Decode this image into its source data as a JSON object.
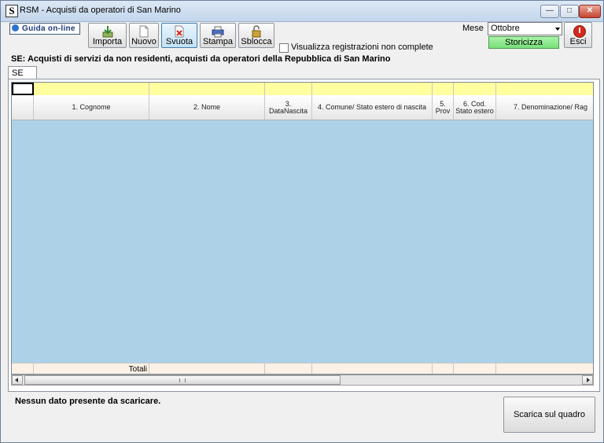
{
  "window": {
    "title": "RSM - Acquisti da operatori di San Marino",
    "app_icon_letter": "S",
    "controls": {
      "minimize": "—",
      "maximize": "□",
      "close": "✕"
    }
  },
  "toolbar": {
    "guide_label": "Guida on-line",
    "import_label": "Importa",
    "new_label": "Nuovo",
    "clear_label": "Svuota",
    "print_label": "Stampa",
    "unlock_label": "Sblocca",
    "incomplete_checkbox_label": "Visualizza registrazioni non complete",
    "month_label": "Mese",
    "month_value": "Ottobre",
    "storicizza_label": "Storicizza",
    "exit_label": "Esci"
  },
  "heading": "SE: Acquisti di servizi da non residenti, acquisti da operatori della Repubblica di San Marino",
  "tab_label": "SE",
  "grid": {
    "columns": [
      "1. Cognome",
      "2. Nome",
      "3. DataNascita",
      "4. Comune/ Stato estero di nascita",
      "5. Prov",
      "6. Cod. Stato estero",
      "7. Denominazione/ Rag"
    ],
    "totals_label": "Totali",
    "grip_label": "III"
  },
  "status_message": "Nessun dato presente da scaricare.",
  "download_button_label": "Scarica sul quadro",
  "colors": {
    "grid_background": "#add2e8",
    "filter_row": "#ffffa0",
    "totals_row": "#fbf1e5",
    "storicizza": "#78e078",
    "exit_icon": "#d42a1e"
  }
}
